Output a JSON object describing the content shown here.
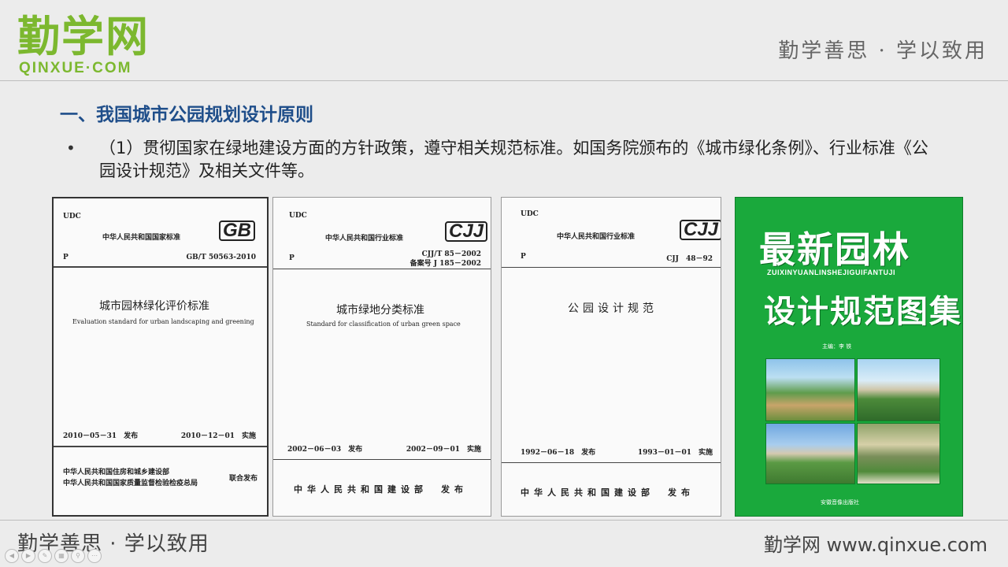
{
  "brand": {
    "logo_cn": "勤学网",
    "logo_en": "QINXUE·COM",
    "motto": "勤学善思 · 学以致用",
    "site": "勤学网 www.qinxue.com",
    "logo_color": "#7cb82f"
  },
  "slide": {
    "heading": "一、我国城市公园规划设计原则",
    "bullet": "•",
    "paragraph": "（1）贯彻国家在绿地建设方面的方针政策，遵守相关规范标准。如国务院颁布的《城市绿化条例》、行业标准《公园设计规范》及相关文件等。",
    "heading_color": "#1f4e8a"
  },
  "covers": [
    {
      "udc": "UDC",
      "issuer": "中华人民共和国国家标准",
      "mark": "GB",
      "p": "P",
      "code": "GB/T 50563-2010",
      "title": "城市园林绿化评价标准",
      "subtitle": "Evaluation standard for urban landscaping and greening",
      "date_left": "2010－05－31　发布",
      "date_right": "2010－12－01　实施",
      "publisher_1": "中华人民共和国住房和城乡建设部",
      "publisher_2": "中华人民共和国国家质量监督检验检疫总局",
      "publisher_joint": "联合发布"
    },
    {
      "udc": "UDC",
      "issuer": "中华人民共和国行业标准",
      "mark": "CJJ",
      "p": "P",
      "code": "CJJ/T 85－2002",
      "code2": "备案号 J 185－2002",
      "title": "城市绿地分类标准",
      "subtitle": "Standard for classification of urban green space",
      "date_left": "2002－06－03　发布",
      "date_right": "2002－09－01　实施",
      "publisher": "中华人民共和国建设部　发布"
    },
    {
      "udc": "UDC",
      "issuer": "中华人民共和国行业标准",
      "mark": "CJJ",
      "p": "P",
      "code": "CJJ　48－92",
      "title": "公园设计规范",
      "date_left": "1992－06－18　发布",
      "date_right": "1993－01－01　实施",
      "publisher": "中华人民共和国建设部　发布"
    },
    {
      "title_1": "最新园林",
      "pinyin": "ZUIXINYUANLINSHEJIGUIFANTUJI",
      "title_2": "设计规范图集",
      "editor": "主编：李 铁",
      "publisher": "安徽音像出版社",
      "bg_color": "#1aa93c"
    }
  ],
  "nav": {
    "icons": [
      "prev-icon",
      "next-icon",
      "pen-icon",
      "menu-icon",
      "zoom-icon",
      "more-icon"
    ]
  }
}
